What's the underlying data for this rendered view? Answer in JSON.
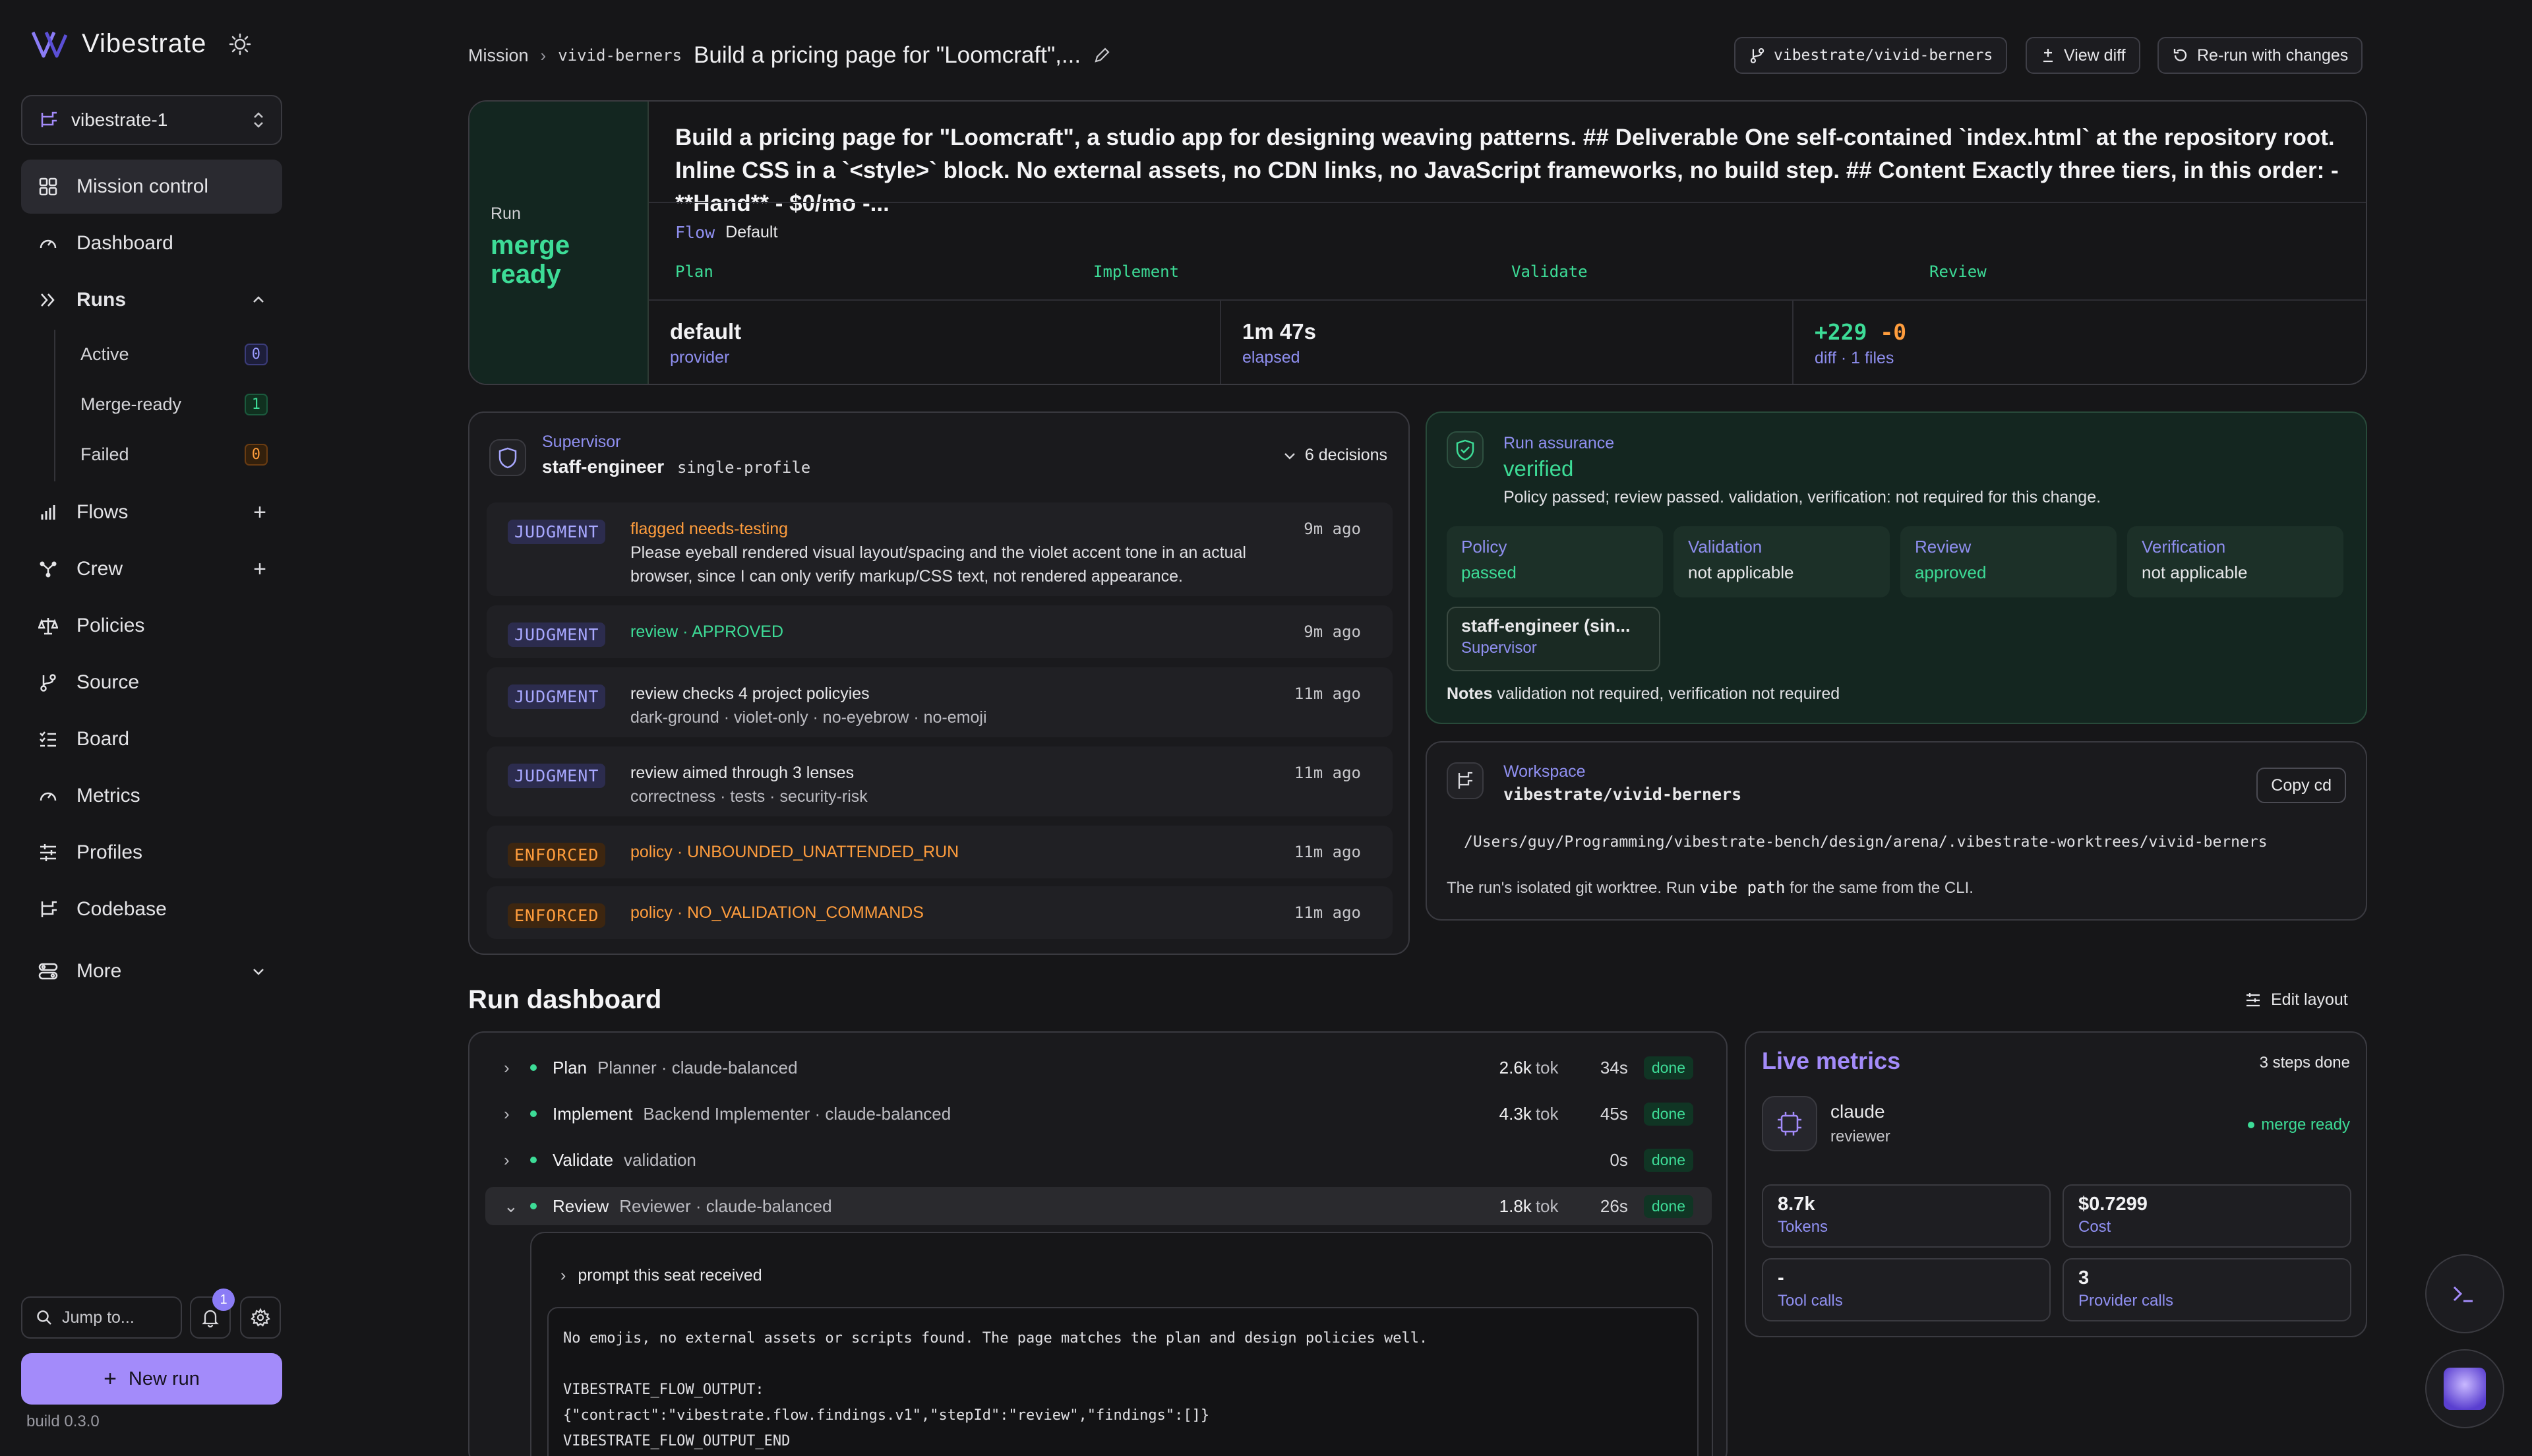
{
  "app": {
    "name": "Vibestrate",
    "workspace": "vibestrate-1",
    "build": "build 0.3.0"
  },
  "sidebar": {
    "items": [
      {
        "label": "Mission control"
      },
      {
        "label": "Dashboard"
      },
      {
        "label": "Runs"
      },
      {
        "label": "Flows"
      },
      {
        "label": "Crew"
      },
      {
        "label": "Policies"
      },
      {
        "label": "Source"
      },
      {
        "label": "Board"
      },
      {
        "label": "Metrics"
      },
      {
        "label": "Profiles"
      },
      {
        "label": "Codebase"
      },
      {
        "label": "More"
      }
    ],
    "runs_sub": [
      {
        "label": "Active",
        "count": "0"
      },
      {
        "label": "Merge-ready",
        "count": "1"
      },
      {
        "label": "Failed",
        "count": "0"
      }
    ],
    "jump_placeholder": "Jump to...",
    "notif_count": "1",
    "new_run": "New run"
  },
  "header": {
    "crumb_root": "Mission",
    "crumb_branch": "vivid-berners",
    "title": "Build a pricing page for \"Loomcraft\",...",
    "repo_btn": "vibestrate/vivid-berners",
    "diff_btn": "View diff",
    "rerun_btn": "Re-run with changes"
  },
  "mission": {
    "run_label": "Run",
    "state_line1": "merge",
    "state_line2": "ready",
    "prompt": "Build a pricing page for \"Loomcraft\", a studio app for designing weaving patterns. ## Deliverable One self-contained `index.html` at the repository root. Inline CSS in a `<style>` block. No external assets, no CDN links, no JavaScript frameworks, no build step. ## Content Exactly three tiers, in this order: - **Hand** - $0/mo -...",
    "flow_key": "Flow",
    "flow_val": "Default",
    "stages": [
      "Plan",
      "Implement",
      "Validate",
      "Review"
    ],
    "provider_val": "default",
    "provider_key": "provider",
    "elapsed_val": "1m 47s",
    "elapsed_key": "elapsed",
    "diff_add": "+229",
    "diff_del": "-0",
    "diff_key": "diff · 1 files"
  },
  "supervisor": {
    "title": "Supervisor",
    "name": "staff-engineer",
    "profile": "single-profile",
    "decisions_label": "6 decisions",
    "decisions": [
      {
        "tag": "JUDGMENT",
        "title": "flagged needs-testing",
        "body": "Please eyeball rendered visual layout/spacing and the violet accent tone in an actual browser, since I can only verify markup/CSS text, not rendered appearance.",
        "time": "9m ago"
      },
      {
        "tag": "JUDGMENT",
        "title": "review · APPROVED",
        "body": "",
        "time": "9m ago"
      },
      {
        "tag": "JUDGMENT",
        "title": "review checks 4 project policyies",
        "body": "dark-ground · violet-only · no-eyebrow · no-emoji",
        "time": "11m ago"
      },
      {
        "tag": "JUDGMENT",
        "title": "review aimed through 3 lenses",
        "body": "correctness · tests · security-risk",
        "time": "11m ago"
      },
      {
        "tag": "ENFORCED",
        "title": "policy · UNBOUNDED_UNATTENDED_RUN",
        "body": "",
        "time": "11m ago"
      },
      {
        "tag": "ENFORCED",
        "title": "policy · NO_VALIDATION_COMMANDS",
        "body": "",
        "time": "11m ago"
      }
    ]
  },
  "assurance": {
    "title": "Run assurance",
    "status": "verified",
    "summary": "Policy passed; review passed. validation, verification: not required for this change.",
    "tiles": [
      {
        "k": "Policy",
        "v": "passed"
      },
      {
        "k": "Validation",
        "v": "not applicable"
      },
      {
        "k": "Review",
        "v": "approved"
      },
      {
        "k": "Verification",
        "v": "not applicable"
      }
    ],
    "supervisor_name": "staff-engineer (sin...",
    "supervisor_role": "Supervisor",
    "notes_key": "Notes",
    "notes_val": "validation not required, verification not required"
  },
  "workspace": {
    "title": "Workspace",
    "name": "vibestrate/vivid-berners",
    "copy_btn": "Copy cd",
    "path": "/Users/guy/Programming/vibestrate-bench/design/arena/.vibestrate-worktrees/vivid-berners",
    "note_a": "The run's isolated git worktree. Run",
    "note_cmd": "vibe path",
    "note_b": "for the same from the CLI."
  },
  "dashboard": {
    "title": "Run dashboard",
    "edit_layout": "Edit layout",
    "steps": [
      {
        "name": "Plan",
        "meta": "Planner · claude-balanced",
        "tok": "2.6k",
        "dur": "34s",
        "status": "done"
      },
      {
        "name": "Implement",
        "meta": "Backend Implementer · claude-balanced",
        "tok": "4.3k",
        "dur": "45s",
        "status": "done"
      },
      {
        "name": "Validate",
        "meta": "validation",
        "tok": "",
        "dur": "0s",
        "status": "done"
      },
      {
        "name": "Review",
        "meta": "Reviewer · claude-balanced",
        "tok": "1.8k",
        "dur": "26s",
        "status": "done"
      }
    ],
    "tok_unit": "tok",
    "prompt_label": "prompt this seat received",
    "output": "No emojis, no external assets or scripts found. The page matches the plan and design policies well.\n\nVIBESTRATE_FLOW_OUTPUT:\n{\"contract\":\"vibestrate.flow.findings.v1\",\"stepId\":\"review\",\"findings\":[]}\nVIBESTRATE_FLOW_OUTPUT_END"
  },
  "live": {
    "title": "Live metrics",
    "steps_done": "3 steps done",
    "agent_name": "claude",
    "agent_role": "reviewer",
    "agent_status": "merge ready",
    "tiles": [
      {
        "v": "8.7k",
        "k": "Tokens"
      },
      {
        "v": "$0.7299",
        "k": "Cost"
      },
      {
        "v": "-",
        "k": "Tool calls"
      },
      {
        "v": "3",
        "k": "Provider calls"
      }
    ]
  },
  "colors": {
    "accent": "#a38bfa",
    "success": "#3ddc97",
    "warning": "#ff9d3d",
    "link": "#8f8ff0",
    "background": "#161618"
  }
}
